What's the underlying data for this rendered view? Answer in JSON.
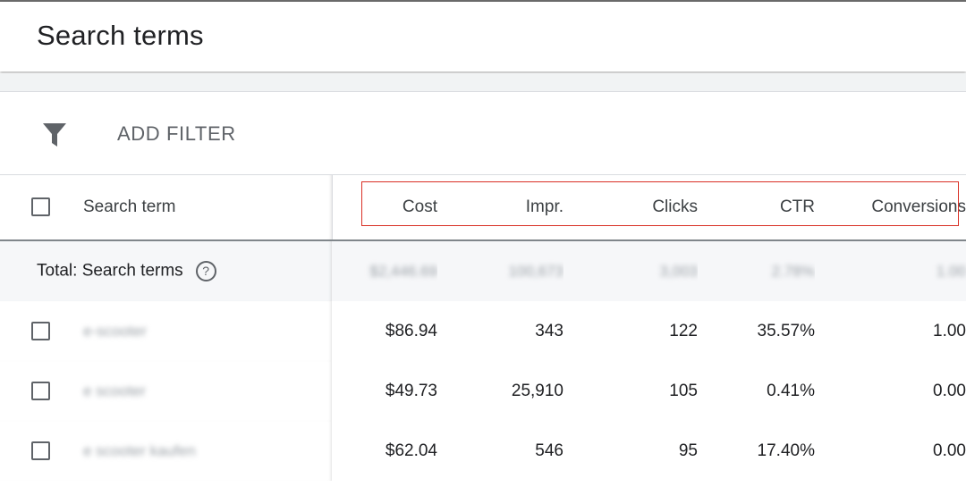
{
  "page": {
    "title": "Search terms"
  },
  "toolbar": {
    "filter_label": "ADD FILTER",
    "filter_icon": "filter-icon"
  },
  "columns": [
    "Search term",
    "Cost",
    "Impr.",
    "Clicks",
    "CTR",
    "Conversions"
  ],
  "total": {
    "label": "Total: Search terms",
    "help_icon": "help-circle-icon",
    "cost": "$2,446.69",
    "impr": "100,673",
    "clicks": "3,003",
    "ctr": "2.78%",
    "conversions": "1.00"
  },
  "rows": [
    {
      "term": "e-scooter",
      "cost": "$86.94",
      "impr": "343",
      "clicks": "122",
      "ctr": "35.57%",
      "conversions": "1.00"
    },
    {
      "term": "e scooter",
      "cost": "$49.73",
      "impr": "25,910",
      "clicks": "105",
      "ctr": "0.41%",
      "conversions": "0.00"
    },
    {
      "term": "e scooter kaufen",
      "cost": "$62.04",
      "impr": "546",
      "clicks": "95",
      "ctr": "17.40%",
      "conversions": "0.00"
    }
  ],
  "colors": {
    "highlight": "#d93025",
    "icon": "#5f6368",
    "total_bg": "#f6f7f9"
  }
}
